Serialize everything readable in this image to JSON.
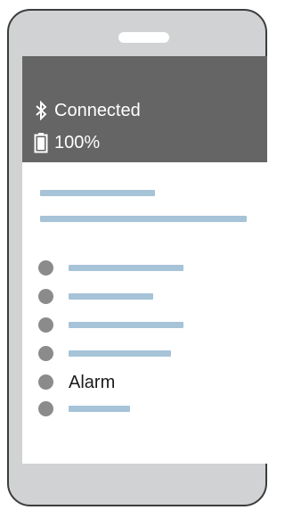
{
  "status": {
    "bluetooth_icon": "bluetooth-icon",
    "connection_label": "Connected",
    "battery_icon": "battery-icon",
    "battery_level": "100%"
  },
  "list": {
    "alarm_label": "Alarm"
  },
  "colors": {
    "phone_frame": "#d1d2d3",
    "status_bar": "#656565",
    "placeholder_line": "#a6c3d8",
    "bullet": "#8b8b8b"
  }
}
